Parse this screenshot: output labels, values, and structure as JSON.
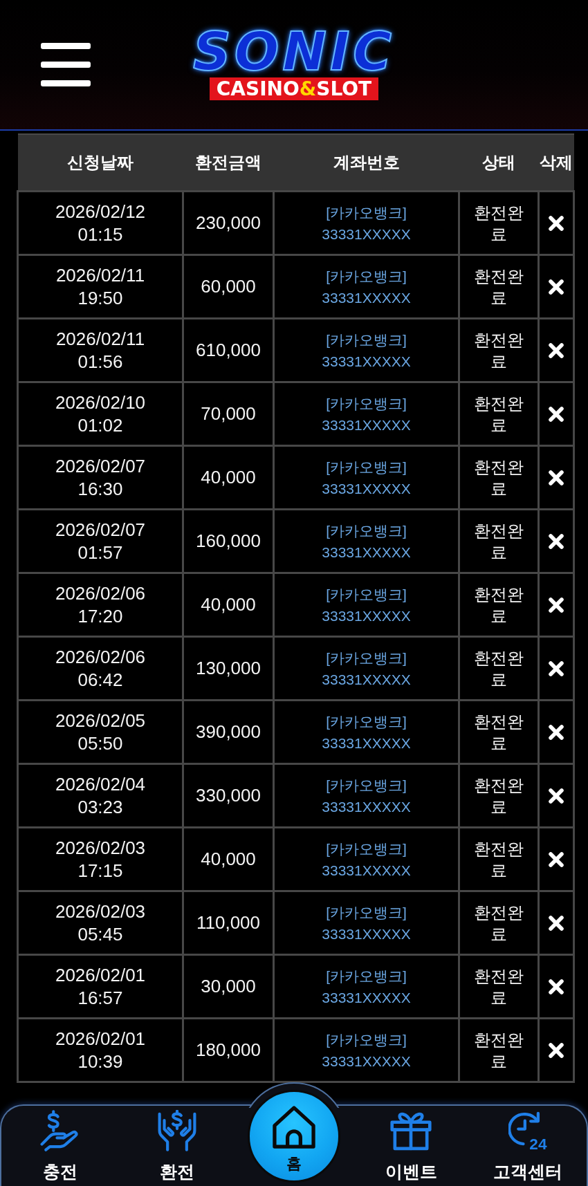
{
  "header": {
    "logo": {
      "title": "SONIC",
      "subtitle": [
        {
          "text": "CASINO",
          "highlight": false
        },
        {
          "text": "&",
          "highlight": true
        },
        {
          "text": "SLOT",
          "highlight": false
        }
      ]
    }
  },
  "table": {
    "columns": [
      "신청날짜",
      "환전금액",
      "계좌번호",
      "상태",
      "삭제"
    ],
    "rows": [
      {
        "date": "2026/02/12",
        "time": "01:15",
        "amount": "230,000",
        "bank": "[카카오뱅크]",
        "account": "33331XXXXX",
        "status": "환전완료"
      },
      {
        "date": "2026/02/11",
        "time": "19:50",
        "amount": "60,000",
        "bank": "[카카오뱅크]",
        "account": "33331XXXXX",
        "status": "환전완료"
      },
      {
        "date": "2026/02/11",
        "time": "01:56",
        "amount": "610,000",
        "bank": "[카카오뱅크]",
        "account": "33331XXXXX",
        "status": "환전완료"
      },
      {
        "date": "2026/02/10",
        "time": "01:02",
        "amount": "70,000",
        "bank": "[카카오뱅크]",
        "account": "33331XXXXX",
        "status": "환전완료"
      },
      {
        "date": "2026/02/07",
        "time": "16:30",
        "amount": "40,000",
        "bank": "[카카오뱅크]",
        "account": "33331XXXXX",
        "status": "환전완료"
      },
      {
        "date": "2026/02/07",
        "time": "01:57",
        "amount": "160,000",
        "bank": "[카카오뱅크]",
        "account": "33331XXXXX",
        "status": "환전완료"
      },
      {
        "date": "2026/02/06",
        "time": "17:20",
        "amount": "40,000",
        "bank": "[카카오뱅크]",
        "account": "33331XXXXX",
        "status": "환전완료"
      },
      {
        "date": "2026/02/06",
        "time": "06:42",
        "amount": "130,000",
        "bank": "[카카오뱅크]",
        "account": "33331XXXXX",
        "status": "환전완료"
      },
      {
        "date": "2026/02/05",
        "time": "05:50",
        "amount": "390,000",
        "bank": "[카카오뱅크]",
        "account": "33331XXXXX",
        "status": "환전완료"
      },
      {
        "date": "2026/02/04",
        "time": "03:23",
        "amount": "330,000",
        "bank": "[카카오뱅크]",
        "account": "33331XXXXX",
        "status": "환전완료"
      },
      {
        "date": "2026/02/03",
        "time": "17:15",
        "amount": "40,000",
        "bank": "[카카오뱅크]",
        "account": "33331XXXXX",
        "status": "환전완료"
      },
      {
        "date": "2026/02/03",
        "time": "05:45",
        "amount": "110,000",
        "bank": "[카카오뱅크]",
        "account": "33331XXXXX",
        "status": "환전완료"
      },
      {
        "date": "2026/02/01",
        "time": "16:57",
        "amount": "30,000",
        "bank": "[카카오뱅크]",
        "account": "33331XXXXX",
        "status": "환전완료"
      },
      {
        "date": "2026/02/01",
        "time": "10:39",
        "amount": "180,000",
        "bank": "[카카오뱅크]",
        "account": "33331XXXXX",
        "status": "환전완료"
      }
    ]
  },
  "bottom_nav": [
    {
      "kind": "charge",
      "label": "충전"
    },
    {
      "kind": "exchange",
      "label": "환전"
    },
    {
      "kind": "home",
      "label": "홈"
    },
    {
      "kind": "event",
      "label": "이벤트"
    },
    {
      "kind": "support",
      "label": "고객센터",
      "icon_text": "24"
    }
  ]
}
